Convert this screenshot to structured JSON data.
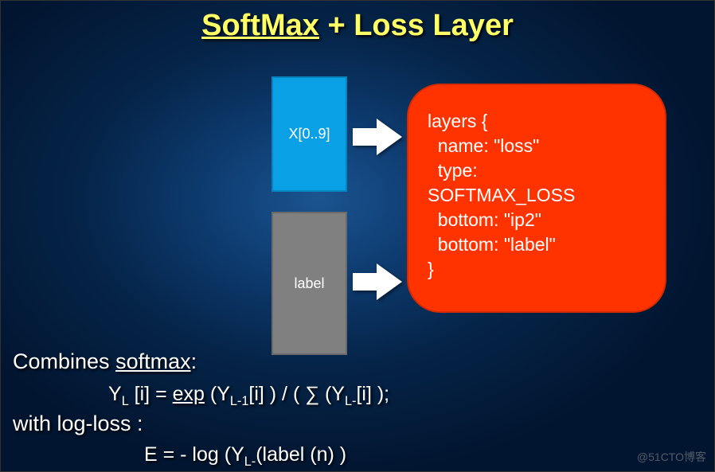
{
  "title": {
    "underlined": "SoftMax",
    "rest": " + Loss Layer"
  },
  "boxes": {
    "input_top": "X[0..9]",
    "input_bottom": "label"
  },
  "code": "layers {\n  name: \"loss\"\n  type:\nSOFTMAX_LOSS\n  bottom: \"ip2\"\n  bottom: \"label\"\n}",
  "explain": {
    "line1_pre": "Combines ",
    "line1_u": "softmax",
    "line1_post": ":",
    "formula1_a": "Y",
    "formula1_sub1": "L",
    "formula1_b": " [i] = ",
    "formula1_exp": "exp",
    "formula1_c": " (Y",
    "formula1_sub2": "L-1",
    "formula1_d": "[i] ) / ( ∑ (Y",
    "formula1_sub3": "L-",
    "formula1_e": "[i] );",
    "line3": "with log-loss :",
    "formula2_a": "E = - log (Y",
    "formula2_sub": "L-",
    "formula2_b": "(label (n) )"
  },
  "watermark": "@51CTO博客"
}
